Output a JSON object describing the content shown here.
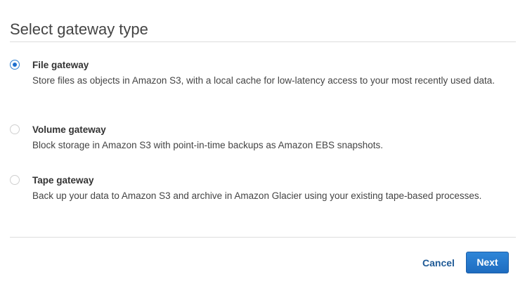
{
  "page": {
    "title": "Select gateway type"
  },
  "options": [
    {
      "label": "File gateway",
      "description": "Store files as objects in Amazon S3, with a local cache for low-latency access to your most recently used data.",
      "selected": true
    },
    {
      "label": "Volume gateway",
      "description": "Block storage in Amazon S3 with point-in-time backups as Amazon EBS snapshots.",
      "selected": false
    },
    {
      "label": "Tape gateway",
      "description": "Back up your data to Amazon S3 and archive in Amazon Glacier using your existing tape-based processes.",
      "selected": false
    }
  ],
  "footer": {
    "cancel_label": "Cancel",
    "next_label": "Next"
  },
  "colors": {
    "accent": "#1e6cc0",
    "link": "#1f5a96"
  }
}
